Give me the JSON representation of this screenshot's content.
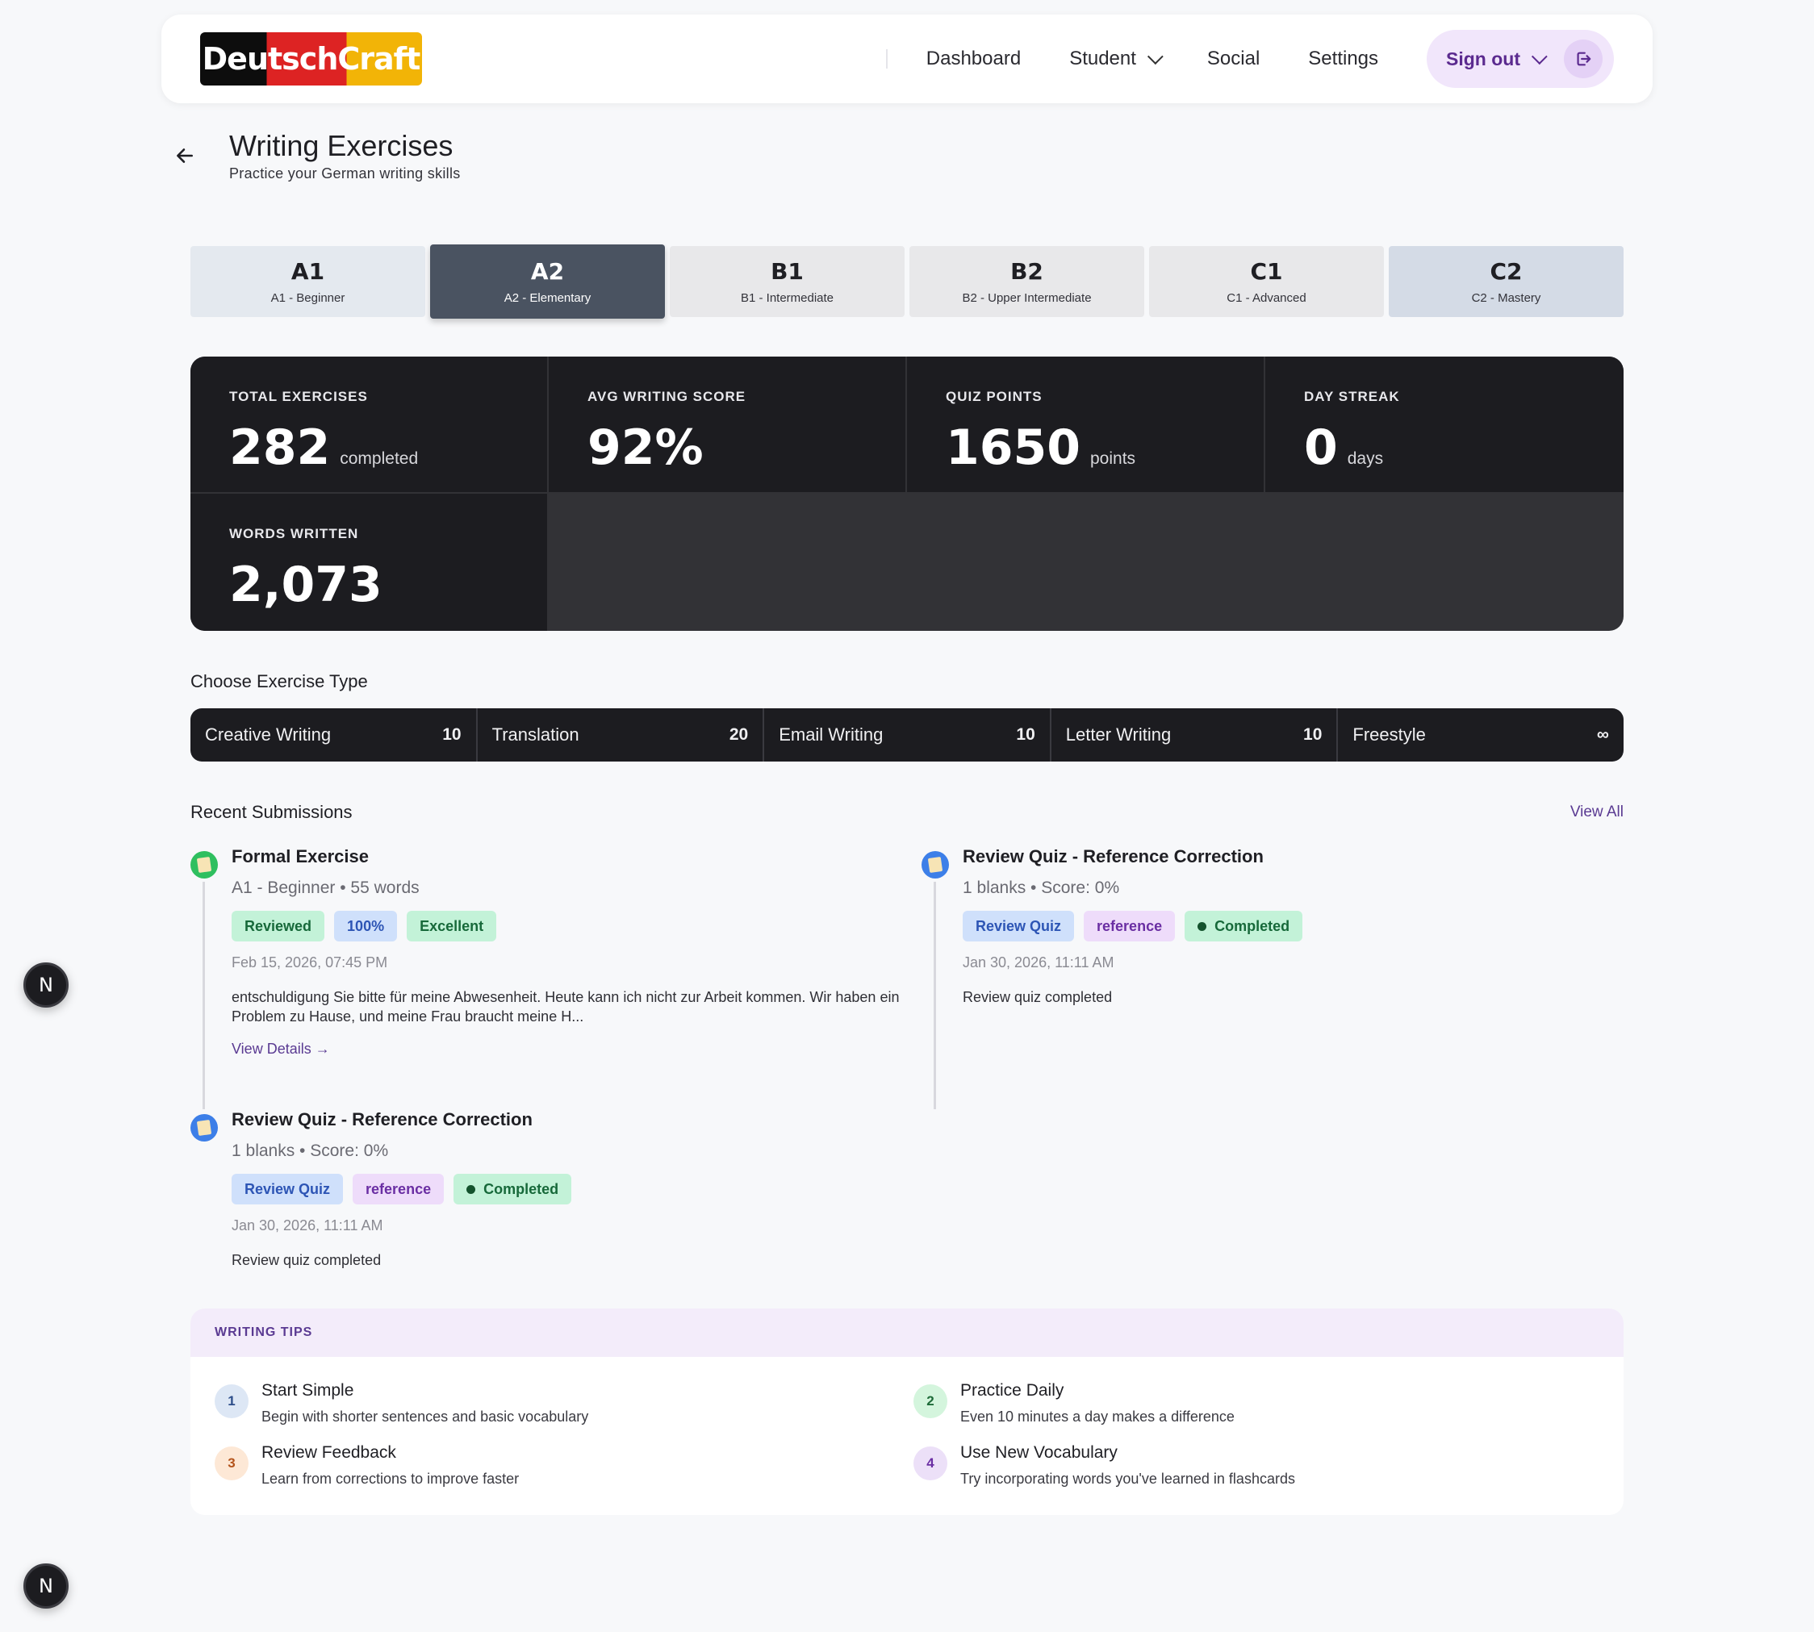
{
  "header": {
    "logo_text": "DeutschCraft",
    "nav": [
      "Dashboard",
      "Student",
      "Social",
      "Settings"
    ],
    "signout_label": "Sign out"
  },
  "page": {
    "title": "Writing Exercises",
    "subtitle": "Practice your German writing skills"
  },
  "levels": [
    {
      "code": "A1",
      "name": "A1 - Beginner"
    },
    {
      "code": "A2",
      "name": "A2 - Elementary"
    },
    {
      "code": "B1",
      "name": "B1 - Intermediate"
    },
    {
      "code": "B2",
      "name": "B2 - Upper Intermediate"
    },
    {
      "code": "C1",
      "name": "C1 - Advanced"
    },
    {
      "code": "C2",
      "name": "C2 - Mastery"
    }
  ],
  "active_level": "A2",
  "stats": [
    {
      "label": "TOTAL EXERCISES",
      "value": "282",
      "unit": "completed"
    },
    {
      "label": "AVG WRITING SCORE",
      "value": "92%",
      "unit": ""
    },
    {
      "label": "QUIZ POINTS",
      "value": "1650",
      "unit": "points"
    },
    {
      "label": "DAY STREAK",
      "value": "0",
      "unit": "days"
    },
    {
      "label": "WORDS WRITTEN",
      "value": "2,073",
      "unit": ""
    }
  ],
  "exercise_section_title": "Choose Exercise Type",
  "exercise_types": [
    {
      "name": "Creative Writing",
      "count": "10"
    },
    {
      "name": "Translation",
      "count": "20"
    },
    {
      "name": "Email Writing",
      "count": "10"
    },
    {
      "name": "Letter Writing",
      "count": "10"
    },
    {
      "name": "Freestyle",
      "count": "∞"
    }
  ],
  "recent": {
    "title": "Recent Submissions",
    "view_all": "View All",
    "items": [
      {
        "title": "Formal Exercise",
        "meta": "A1 - Beginner • 55 words",
        "tags": [
          "Reviewed",
          "100%",
          "Excellent"
        ],
        "date": "Feb 15, 2026, 07:45 PM",
        "excerpt": "entschuldigung Sie bitte für meine Abwesenheit. Heute kann ich nicht zur Arbeit kommen. Wir haben ein Problem zu Hause, und meine Frau braucht meine H...",
        "details": "View Details →"
      },
      {
        "title": "Review Quiz - Reference Correction",
        "meta": "1 blanks • Score: 0%",
        "tags": [
          "Review Quiz",
          "reference",
          "Completed"
        ],
        "date": "Jan 30, 2026, 11:11 AM",
        "excerpt": "Review quiz completed"
      },
      {
        "title": "Review Quiz - Reference Correction",
        "meta": "1 blanks • Score: 0%",
        "tags": [
          "Review Quiz",
          "reference",
          "Completed"
        ],
        "date": "Jan 30, 2026, 11:11 AM",
        "excerpt": "Review quiz completed"
      }
    ]
  },
  "tips": {
    "title": "WRITING TIPS",
    "items": [
      {
        "num": "1",
        "title": "Start Simple",
        "desc": "Begin with shorter sentences and basic vocabulary"
      },
      {
        "num": "2",
        "title": "Practice Daily",
        "desc": "Even 10 minutes a day makes a difference"
      },
      {
        "num": "3",
        "title": "Review Feedback",
        "desc": "Learn from corrections to improve faster"
      },
      {
        "num": "4",
        "title": "Use New Vocabulary",
        "desc": "Try incorporating words you've learned in flashcards"
      }
    ]
  },
  "badge_letter": "N"
}
